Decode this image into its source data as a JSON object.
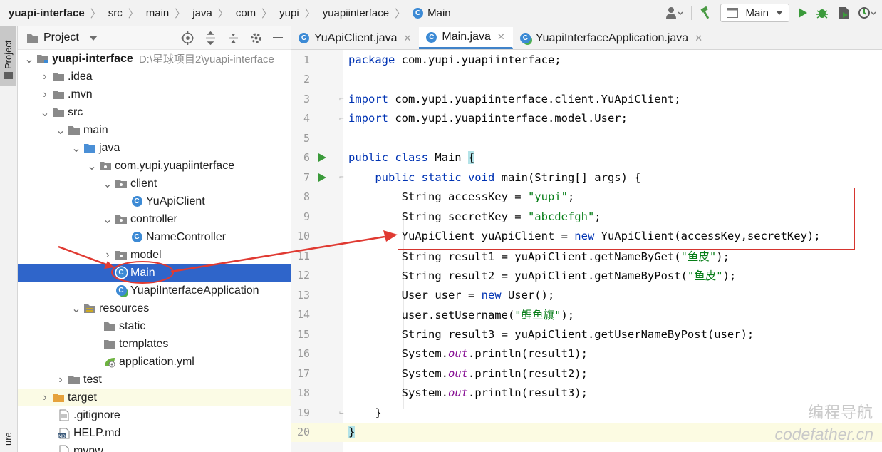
{
  "breadcrumb": {
    "items": [
      "yuapi-interface",
      "src",
      "main",
      "java",
      "com",
      "yupi",
      "yuapiinterface",
      "Main"
    ]
  },
  "toolbar": {
    "run_config": "Main",
    "icons": [
      "user-icon",
      "hammer-icon",
      "run-icon",
      "debug-icon",
      "coverage-icon",
      "profile-icon"
    ]
  },
  "left_stripe": {
    "project_tab": "Project",
    "bottom_tab": "ure"
  },
  "project_panel": {
    "title": "Project",
    "rows": [
      {
        "label": "yuapi-interface",
        "hint": "D:\\星球项目2\\yuapi-interface",
        "bold": true
      },
      {
        "label": ".idea"
      },
      {
        "label": ".mvn"
      },
      {
        "label": "src"
      },
      {
        "label": "main"
      },
      {
        "label": "java"
      },
      {
        "label": "com.yupi.yuapiinterface"
      },
      {
        "label": "client"
      },
      {
        "label": "YuApiClient"
      },
      {
        "label": "controller"
      },
      {
        "label": "NameController"
      },
      {
        "label": "model"
      },
      {
        "label": "Main",
        "selected": true
      },
      {
        "label": "YuapiInterfaceApplication"
      },
      {
        "label": "resources"
      },
      {
        "label": "static"
      },
      {
        "label": "templates"
      },
      {
        "label": "application.yml"
      },
      {
        "label": "test"
      },
      {
        "label": "target"
      },
      {
        "label": ".gitignore"
      },
      {
        "label": "HELP.md"
      },
      {
        "label": "mvnw"
      }
    ]
  },
  "editor": {
    "tabs": [
      {
        "label": "YuApiClient.java",
        "active": false
      },
      {
        "label": "Main.java",
        "active": true
      },
      {
        "label": "YuapiInterfaceApplication.java",
        "active": false
      }
    ],
    "lines": [
      {
        "n": "1",
        "text": "package com.yupi.yuapiinterface;"
      },
      {
        "n": "2",
        "text": ""
      },
      {
        "n": "3",
        "text": "import com.yupi.yuapiinterface.client.YuApiClient;"
      },
      {
        "n": "4",
        "text": "import com.yupi.yuapiinterface.model.User;"
      },
      {
        "n": "5",
        "text": ""
      },
      {
        "n": "6",
        "text": "public class Main {"
      },
      {
        "n": "7",
        "text": "    public static void main(String[] args) {"
      },
      {
        "n": "8",
        "text": "        String accessKey = \"yupi\";"
      },
      {
        "n": "9",
        "text": "        String secretKey = \"abcdefgh\";"
      },
      {
        "n": "10",
        "text": "        YuApiClient yuApiClient = new YuApiClient(accessKey,secretKey);"
      },
      {
        "n": "11",
        "text": "        String result1 = yuApiClient.getNameByGet(\"鱼皮\");"
      },
      {
        "n": "12",
        "text": "        String result2 = yuApiClient.getNameByPost(\"鱼皮\");"
      },
      {
        "n": "13",
        "text": "        User user = new User();"
      },
      {
        "n": "14",
        "text": "        user.setUsername(\"鲤鱼旗\");"
      },
      {
        "n": "15",
        "text": "        String result3 = yuApiClient.getUserNameByPost(user);"
      },
      {
        "n": "16",
        "text": "        System.out.println(result1);"
      },
      {
        "n": "17",
        "text": "        System.out.println(result2);"
      },
      {
        "n": "18",
        "text": "        System.out.println(result3);"
      },
      {
        "n": "19",
        "text": "    }"
      },
      {
        "n": "20",
        "text": "}"
      }
    ]
  },
  "watermark": {
    "line1": "编程导航",
    "line2": "codefather.cn"
  },
  "colors": {
    "selection": "#2f65ca",
    "keyword": "#0033b3",
    "string": "#067d17",
    "static_field": "#871094",
    "annotation_red": "#e03a32",
    "run_green": "#3a9a3a"
  }
}
